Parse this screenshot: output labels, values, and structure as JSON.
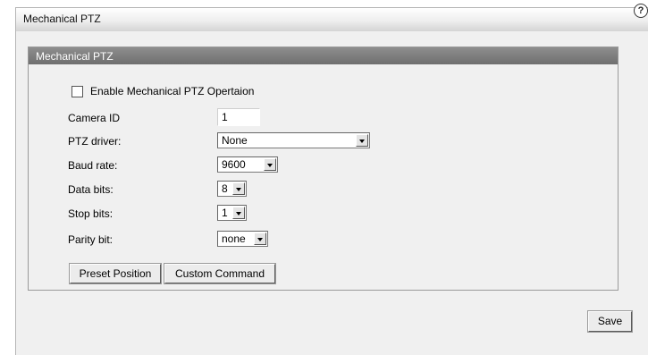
{
  "outer": {
    "title": "Mechanical PTZ",
    "help": "?"
  },
  "panel": {
    "title": "Mechanical PTZ"
  },
  "enable": {
    "label": "Enable Mechanical PTZ Opertaion",
    "checked": false
  },
  "fields": {
    "camera_id": {
      "label": "Camera ID",
      "value": "1"
    },
    "ptz_driver": {
      "label": "PTZ driver:",
      "value": "None"
    },
    "baud_rate": {
      "label": "Baud rate:",
      "value": "9600"
    },
    "data_bits": {
      "label": "Data bits:",
      "value": "8"
    },
    "stop_bits": {
      "label": "Stop bits:",
      "value": "1"
    },
    "parity_bit": {
      "label": "Parity bit:",
      "value": "none"
    }
  },
  "buttons": {
    "preset": "Preset Position",
    "custom": "Custom Command",
    "save": "Save"
  },
  "icons": {
    "help": "help-icon",
    "dropdown": "chevron-down-icon"
  }
}
